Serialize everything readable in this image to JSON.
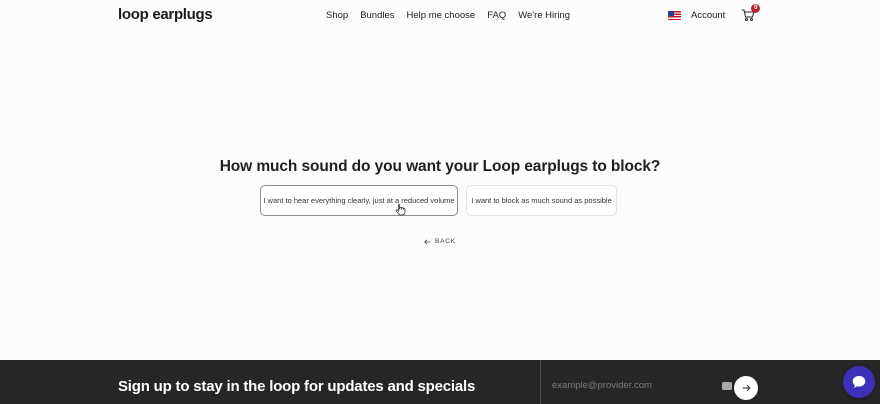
{
  "header": {
    "logo": "loop earplugs",
    "nav": [
      "Shop",
      "Bundles",
      "Help me choose",
      "FAQ",
      "We're Hiring"
    ],
    "account": "Account",
    "cart_count": "0"
  },
  "quiz": {
    "question": "How much sound do you want your Loop earplugs to block?",
    "options": [
      "I want to hear everything clearly, just at a reduced volume",
      "I want to block as much sound as possible"
    ],
    "back": "BACK"
  },
  "footer": {
    "signup_title": "Sign up to stay in the loop for updates and specials",
    "email_placeholder": "example@provider.com"
  },
  "colors": {
    "footer_bg": "#262626",
    "chat_button": "#3e2fb8",
    "cart_badge": "#b3272e"
  },
  "icons": [
    "us-flag-icon",
    "cart-icon",
    "pointer-cursor-icon",
    "arrow-left-icon",
    "arrow-right-icon",
    "chat-bubble-icon",
    "autofill-key-icon"
  ]
}
